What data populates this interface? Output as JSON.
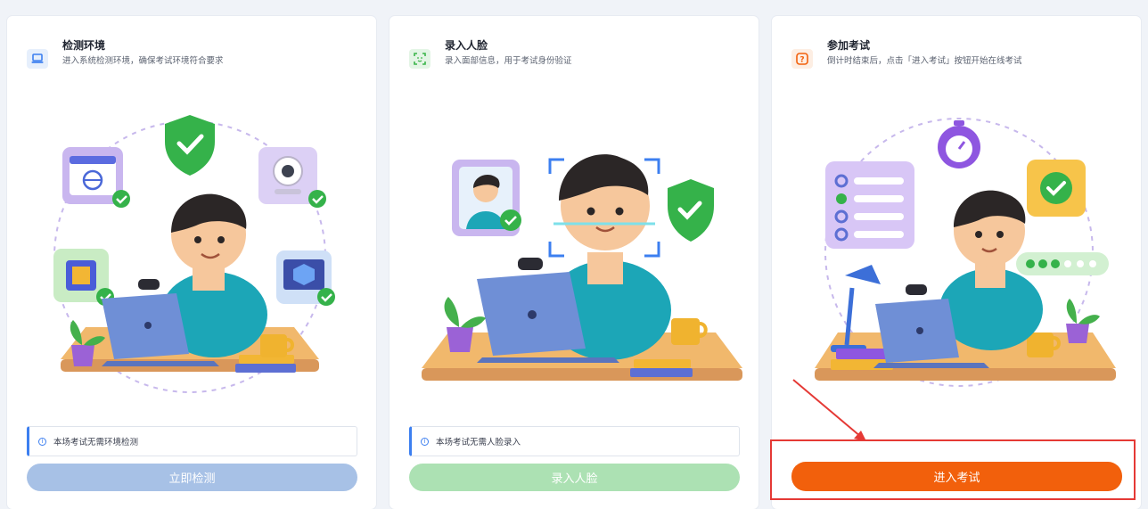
{
  "cards": [
    {
      "title": "检测环境",
      "desc": "进入系统检测环境，确保考试环境符合要求",
      "notice": "本场考试无需环境检测",
      "button": "立即检测",
      "icon": "laptop-icon",
      "accent": "#3c7ff0"
    },
    {
      "title": "录入人脸",
      "desc": "录入面部信息，用于考试身份验证",
      "notice": "本场考试无需人脸录入",
      "button": "录入人脸",
      "icon": "face-scan-icon",
      "accent": "#3bb54a"
    },
    {
      "title": "参加考试",
      "desc": "倒计时结束后，点击「进入考试」按钮开始在线考试",
      "button": "进入考试",
      "icon": "question-icon",
      "accent": "#f2600c"
    }
  ],
  "colors": {
    "disabled_blue": "#a7c1e6",
    "disabled_green": "#ace1b3",
    "primary_orange": "#f2600c",
    "annotation_red": "#e53935"
  }
}
